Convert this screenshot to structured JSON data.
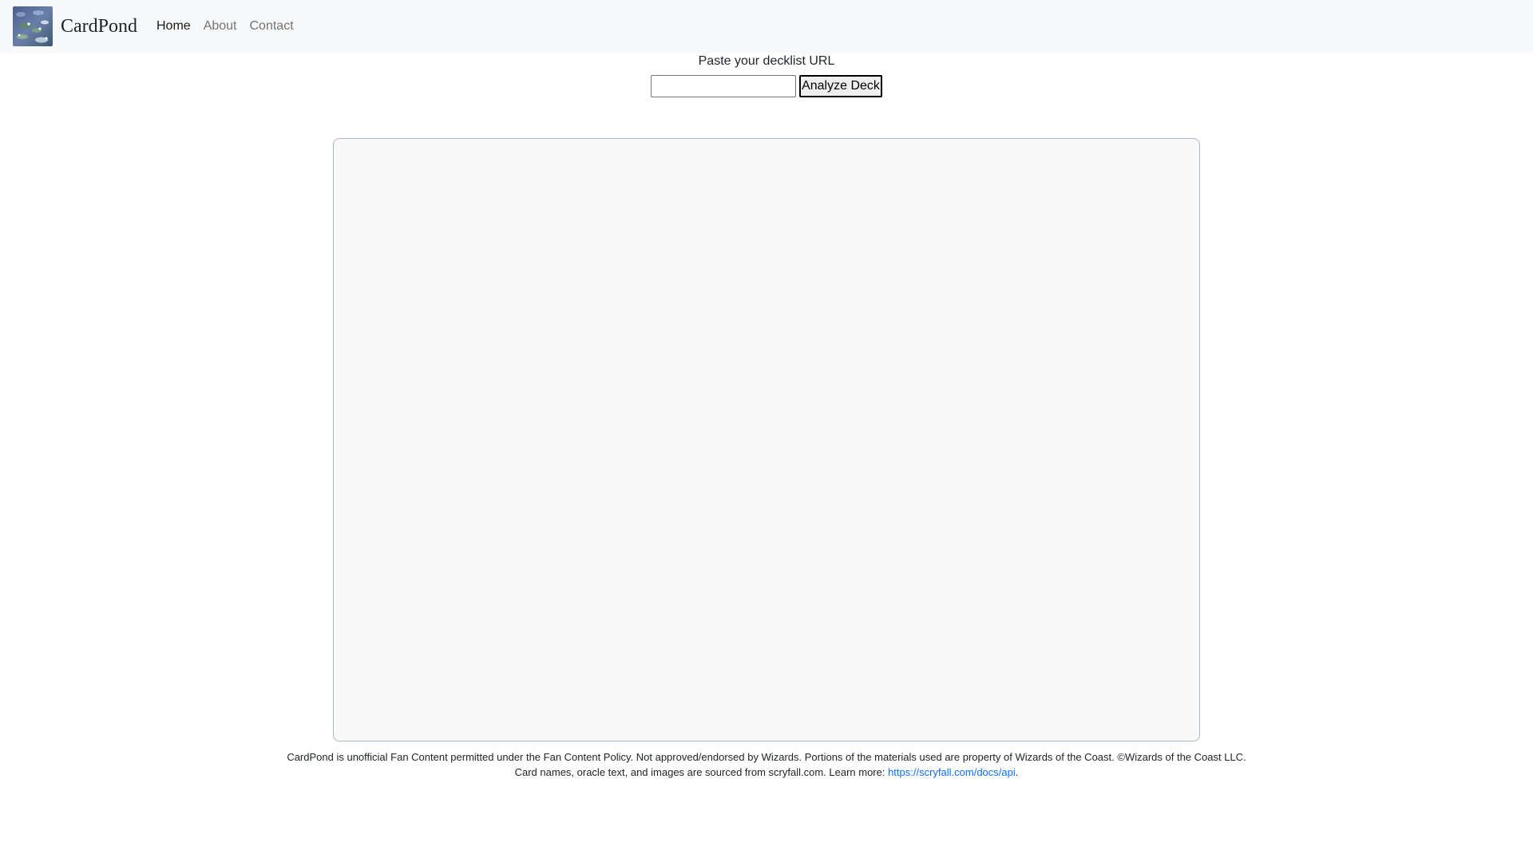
{
  "nav": {
    "brand": "CardPond",
    "items": [
      {
        "label": "Home",
        "active": true
      },
      {
        "label": "About",
        "active": false
      },
      {
        "label": "Contact",
        "active": false
      }
    ]
  },
  "form": {
    "label": "Paste your decklist URL",
    "input_value": "",
    "input_placeholder": "",
    "button_label": "Analyze Deck"
  },
  "footer": {
    "line1": "CardPond is unofficial Fan Content permitted under the Fan Content Policy. Not approved/endorsed by Wizards. Portions of the materials used are property of Wizards of the Coast. ©Wizards of the Coast LLC.",
    "line2_prefix": "Card names, oracle text, and images are sourced from scryfall.com. Learn more: ",
    "line2_link": "https://scryfall.com/docs/api",
    "line2_suffix": "."
  },
  "colors": {
    "navbar_bg": "#f8f9fa",
    "panel_bg": "#f9f9f9",
    "panel_border": "#a9b8c8",
    "link": "#0d6efd"
  }
}
